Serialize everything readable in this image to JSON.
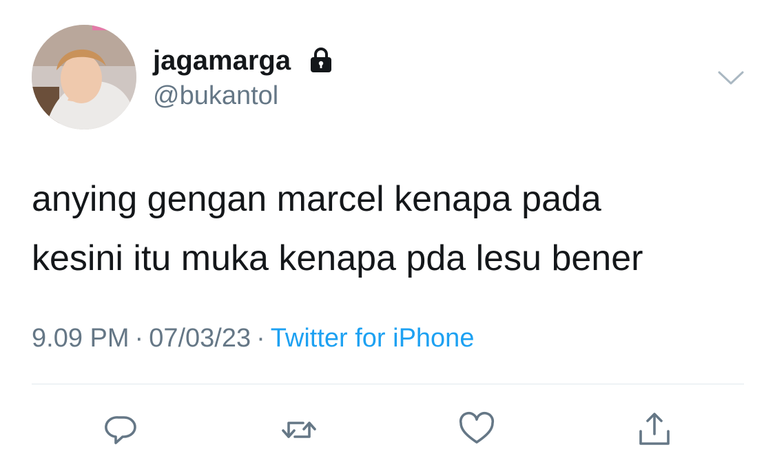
{
  "user": {
    "display_name": "jagamarga",
    "handle": "@bukantol",
    "avatar_icon": "profile-photo",
    "protected_icon": "lock-icon"
  },
  "menu_icon": "chevron-down-icon",
  "tweet": {
    "text": "anying gengan marcel kenapa pada\nkesini itu muka kenapa pda lesu bener"
  },
  "meta": {
    "time": "9.09 PM",
    "separator": "·",
    "date": "07/03/23",
    "source": "Twitter for iPhone"
  },
  "actions": [
    {
      "name": "reply",
      "icon": "reply-icon"
    },
    {
      "name": "retweet",
      "icon": "retweet-icon"
    },
    {
      "name": "like",
      "icon": "heart-icon"
    },
    {
      "name": "share",
      "icon": "share-icon"
    }
  ],
  "colors": {
    "text_primary": "#14171a",
    "text_secondary": "#657786",
    "link": "#1da1f2",
    "divider": "#e1e8ed"
  }
}
